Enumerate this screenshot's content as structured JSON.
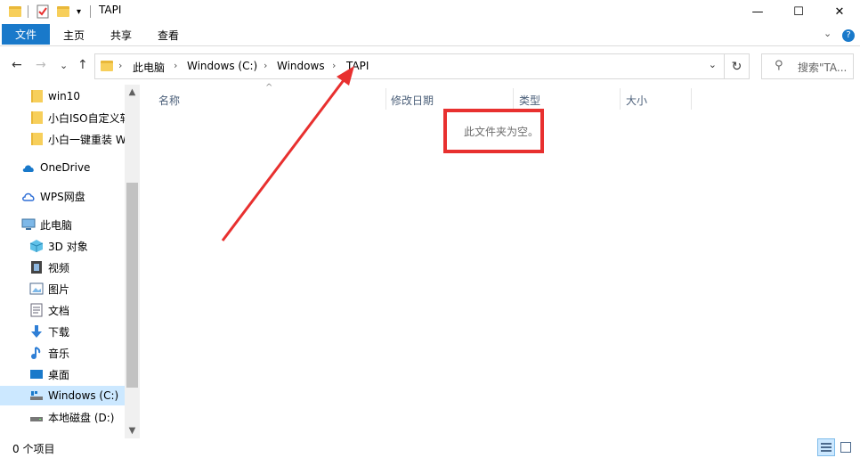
{
  "window": {
    "title": "TAPI",
    "minimize": "—",
    "maximize": "☐",
    "close": "✕"
  },
  "ribbon": {
    "file": "文件",
    "home": "主页",
    "share": "共享",
    "view": "查看",
    "collapse": "⌄",
    "help": "?"
  },
  "nav": {
    "back": "←",
    "forward": "→",
    "recent": "⌄",
    "up": "↑",
    "refresh": "↻"
  },
  "address": {
    "crumbs": [
      "此电脑",
      "Windows (C:)",
      "Windows",
      "TAPI"
    ],
    "separator": "›"
  },
  "search": {
    "placeholder": "搜索\"TA..."
  },
  "sidebar": {
    "items": [
      {
        "label": "win10",
        "icon": "folder-icon"
      },
      {
        "label": "小白ISO自定义软",
        "icon": "folder-icon"
      },
      {
        "label": "小白一键重装 W",
        "icon": "folder-icon"
      },
      {
        "label": "OneDrive",
        "icon": "cloud-icon"
      },
      {
        "label": "WPS网盘",
        "icon": "wps-cloud-icon"
      },
      {
        "label": "此电脑",
        "icon": "computer-icon"
      },
      {
        "label": "3D 对象",
        "icon": "cube-icon"
      },
      {
        "label": "视频",
        "icon": "video-icon"
      },
      {
        "label": "图片",
        "icon": "picture-icon"
      },
      {
        "label": "文档",
        "icon": "document-icon"
      },
      {
        "label": "下载",
        "icon": "download-icon"
      },
      {
        "label": "音乐",
        "icon": "music-icon"
      },
      {
        "label": "桌面",
        "icon": "desktop-icon"
      },
      {
        "label": "Windows (C:)",
        "icon": "drive-icon",
        "selected": true
      },
      {
        "label": "本地磁盘 (D:)",
        "icon": "drive-icon"
      }
    ]
  },
  "columns": [
    "名称",
    "修改日期",
    "类型",
    "大小"
  ],
  "content": {
    "empty_message": "此文件夹为空。"
  },
  "status": {
    "item_count": "0 个项目"
  },
  "colors": {
    "accent": "#1979ca",
    "selection": "#cce8ff",
    "annotation": "#e8302f"
  }
}
